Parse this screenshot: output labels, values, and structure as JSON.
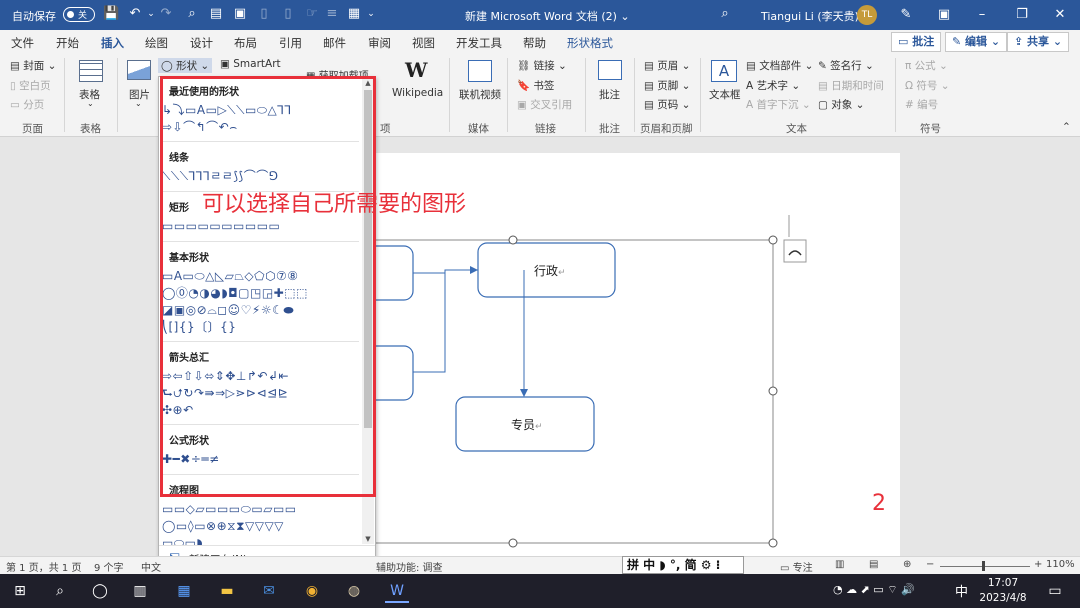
{
  "titlebar": {
    "autosave_label": "自动保存",
    "autosave_state": "关",
    "doc_title": "新建 Microsoft Word 文档 (2) ⌄",
    "user_name": "Tiangui Li (李天贵)",
    "avatar_initials": "TL"
  },
  "tabs": [
    "文件",
    "开始",
    "插入",
    "绘图",
    "设计",
    "布局",
    "引用",
    "邮件",
    "审阅",
    "视图",
    "开发工具",
    "帮助",
    "形状格式"
  ],
  "active_tab": "插入",
  "ribbon_right": {
    "comment": "批注",
    "edit": "编辑",
    "share": "共享"
  },
  "ribbon": {
    "pages": {
      "cover": "封面",
      "blank": "空白页",
      "break": "分页",
      "group": "页面"
    },
    "table": {
      "label": "表格",
      "group": "表格"
    },
    "picture": "图片",
    "shapes_btn": "形状",
    "smartart": "SmartArt",
    "get_addins": "获取加载项",
    "group_addins": "项",
    "wikipedia": "Wikipedia",
    "online_video": "联机视频",
    "group_media": "媒体",
    "link": "链接",
    "bookmark": "书签",
    "crossref": "交叉引用",
    "group_links": "链接",
    "comment": "批注",
    "group_comment": "批注",
    "header": "页眉",
    "footer": "页脚",
    "page_number": "页码",
    "group_hf": "页眉和页脚",
    "textbox": "文本框",
    "quick_parts": "文档部件",
    "wordart": "艺术字",
    "dropcap": "首字下沉",
    "signature": "签名行",
    "datetime": "日期和时间",
    "object": "对象",
    "group_text": "文本",
    "equation": "公式",
    "symbol": "符号",
    "numbering": "编号",
    "group_symbols": "符号"
  },
  "shapes_menu": {
    "sections": [
      {
        "title": "最近使用的形状",
        "rows": [
          "↳⤵▭A▭▷⟍⟍▭⬭△⅂⅂",
          "⇨⇩⌒↰⌒↶⌢"
        ]
      },
      {
        "title": "线条",
        "rows": [
          "⟍⟍⟍⅂⅂⅂ㄹㄹ⟆⟆⌒⌒⅁"
        ]
      },
      {
        "title": "矩形",
        "rows": [
          "▭▭▭▭▭▭▭▭▭▭"
        ]
      },
      {
        "title": "基本形状",
        "rows": [
          "▭A▭⬭△◺▱⏢◇⬠⬡⑦⑧",
          "◯⓪◔◑◕◗◘▢◳◲✚⬚⬚",
          "◪▣◎⊘⌓◻☺♡⚡☼☾⬬",
          "⎝[]{}〔〕{}"
        ]
      },
      {
        "title": "箭头总汇",
        "rows": [
          "⇨⇦⇧⇩⬄⇕✥⊥↱↶↲⇤",
          "⮑⮍↻↷⇛⇒▷⋗⊳⊲⊴⊵",
          "✣⊕↶"
        ]
      },
      {
        "title": "公式形状",
        "rows": [
          "✚━✖÷═≠"
        ]
      },
      {
        "title": "流程图",
        "rows": [
          "▭▭◇▱▭▭▭⬭▭▱▭▭",
          "◯▭◊▭⊗⊕⧖⧗▽▽▽▽",
          "▭⬭▭◗"
        ]
      }
    ],
    "new_canvas": "新建画布(N)"
  },
  "annotation": "可以选择自己所需要的图形",
  "page_number_mark": "2",
  "diagram": {
    "box_admin": "行政",
    "box_clerk": "专员",
    "para_mark": "↵"
  },
  "statusbar": {
    "page": "第 1 页，共 1 页",
    "words": "9 个字",
    "lang": "中文",
    "accessibility": "辅助功能: 调查",
    "ime": "拼 中 ◗ °, 简 ⚙ ⁝",
    "focus": "专注",
    "zoom": "110%"
  },
  "taskbar": {
    "time": "17:07",
    "date": "2023/4/8",
    "ime": "中"
  }
}
